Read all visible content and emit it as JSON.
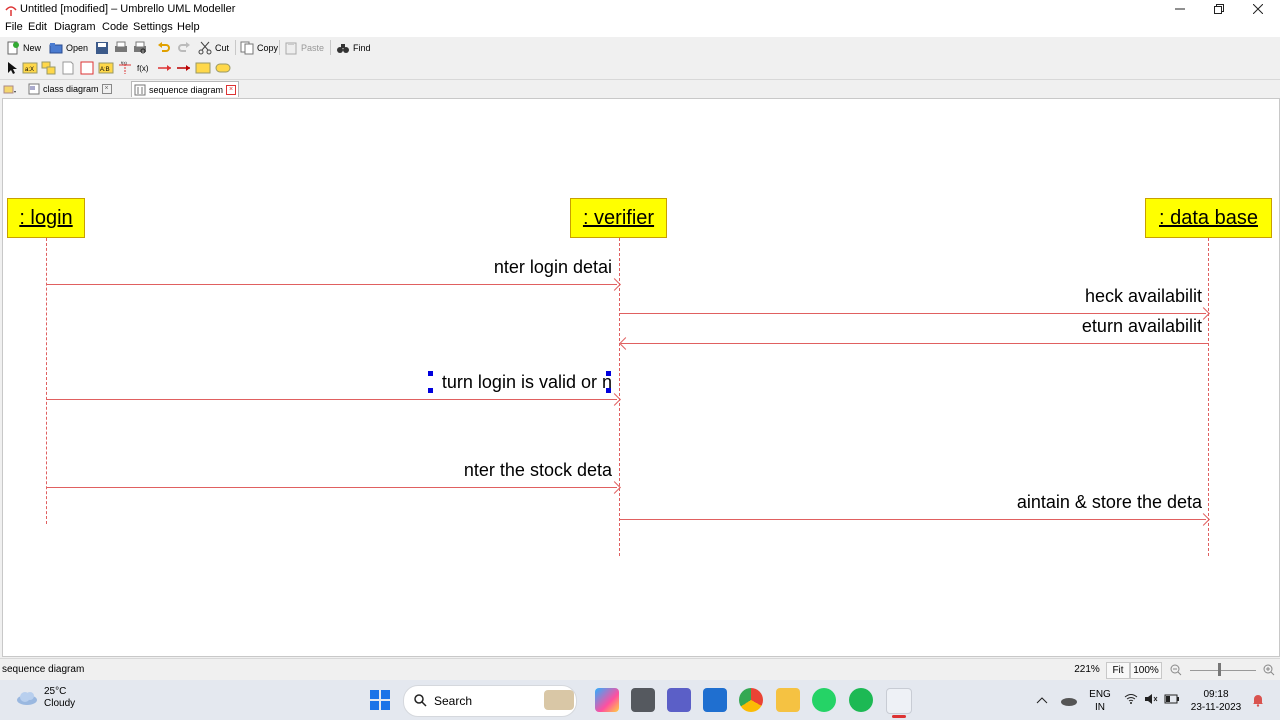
{
  "window": {
    "title": "Untitled [modified] – Umbrello UML Modeller",
    "controls": [
      "minimize-icon",
      "restore-icon",
      "close-icon"
    ]
  },
  "menu": [
    "File",
    "Edit",
    "Diagram",
    "Code",
    "Settings",
    "Help"
  ],
  "toolbar": {
    "new": "New",
    "open": "Open",
    "cut": "Cut",
    "copy": "Copy",
    "paste": "Paste",
    "find": "Find"
  },
  "tabs": [
    {
      "label": "class diagram",
      "active": false
    },
    {
      "label": "sequence diagram",
      "active": true
    }
  ],
  "diagram": {
    "objects": [
      ": login",
      ": verifier",
      ": data base"
    ],
    "messages": [
      "nter login detai",
      "heck availabilit",
      "eturn availabilit",
      "turn login is valid or n",
      "nter the stock deta",
      "aintain & store the deta"
    ]
  },
  "status": {
    "text": "sequence diagram",
    "zoom": "221%",
    "fit": "Fit",
    "hundred": "100%"
  },
  "taskbar": {
    "weather_temp": "25°C",
    "weather_desc": "Cloudy",
    "search_label": "Search",
    "lang": "ENG",
    "region": "IN",
    "time": "09:18",
    "date": "23-11-2023"
  },
  "colors": {
    "object_fill": "#ffff00",
    "message_line": "#e06060",
    "selection_handle": "#0000dd"
  }
}
